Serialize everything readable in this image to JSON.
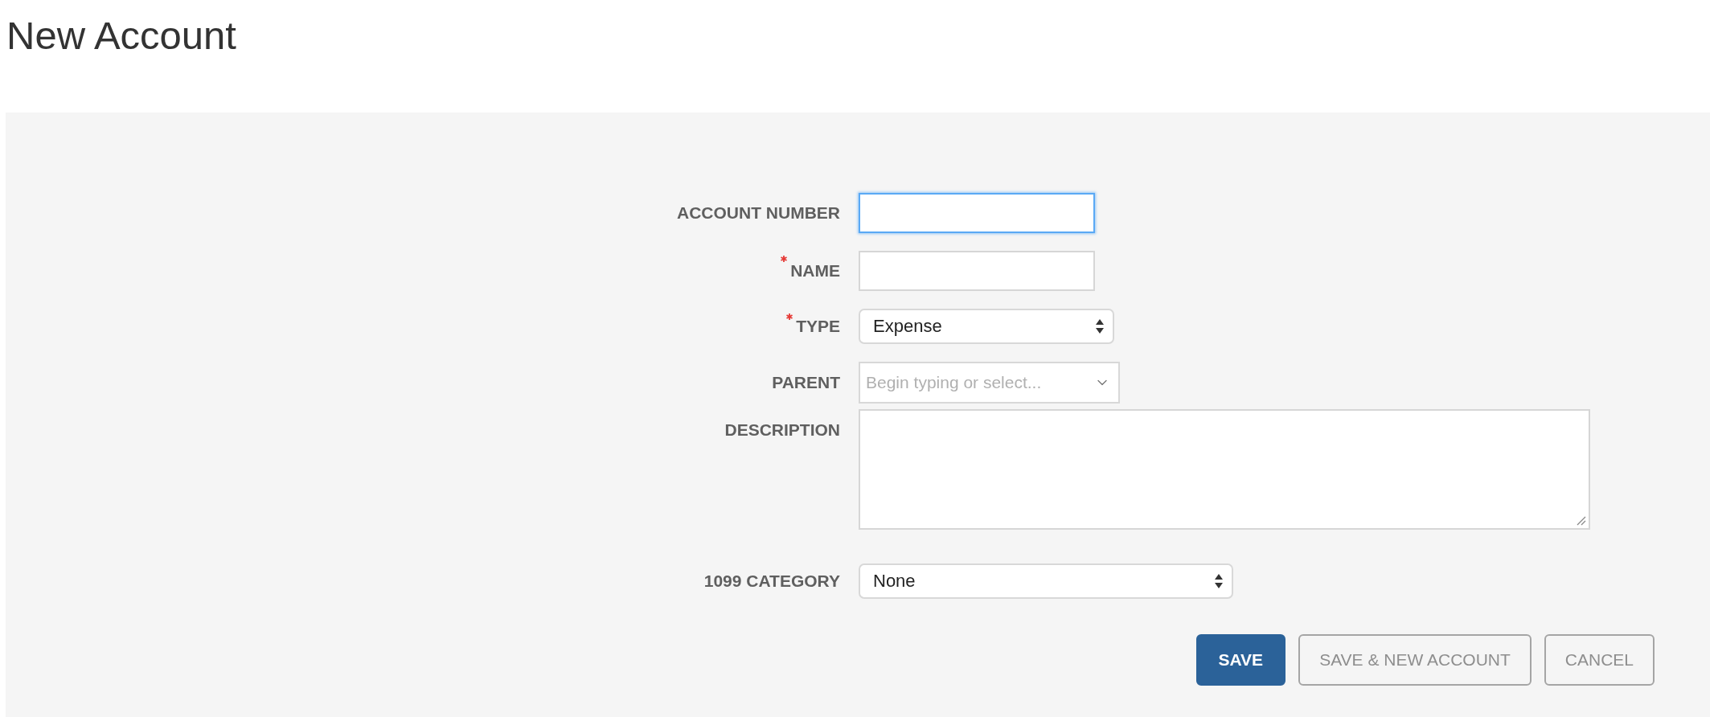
{
  "title": "New Account",
  "fields": [
    {
      "kind": "text",
      "label": "ACCOUNT NUMBER",
      "required": false,
      "focused": true
    },
    {
      "kind": "text",
      "label": "NAME",
      "required": true,
      "focused": false
    },
    {
      "kind": "select",
      "label": "TYPE",
      "required": true,
      "value": "Expense"
    },
    {
      "kind": "combo",
      "label": "PARENT",
      "required": false,
      "placeholder": "Begin typing or select..."
    },
    {
      "kind": "textarea",
      "label": "DESCRIPTION",
      "required": false
    },
    {
      "kind": "wideselect",
      "label": "1099 CATEGORY",
      "required": false,
      "value": "None"
    }
  ],
  "buttons": [
    {
      "kind": "primary",
      "label": "SAVE"
    },
    {
      "kind": "secondary",
      "label": "SAVE & NEW ACCOUNT"
    },
    {
      "kind": "secondary",
      "label": "CANCEL"
    }
  ]
}
